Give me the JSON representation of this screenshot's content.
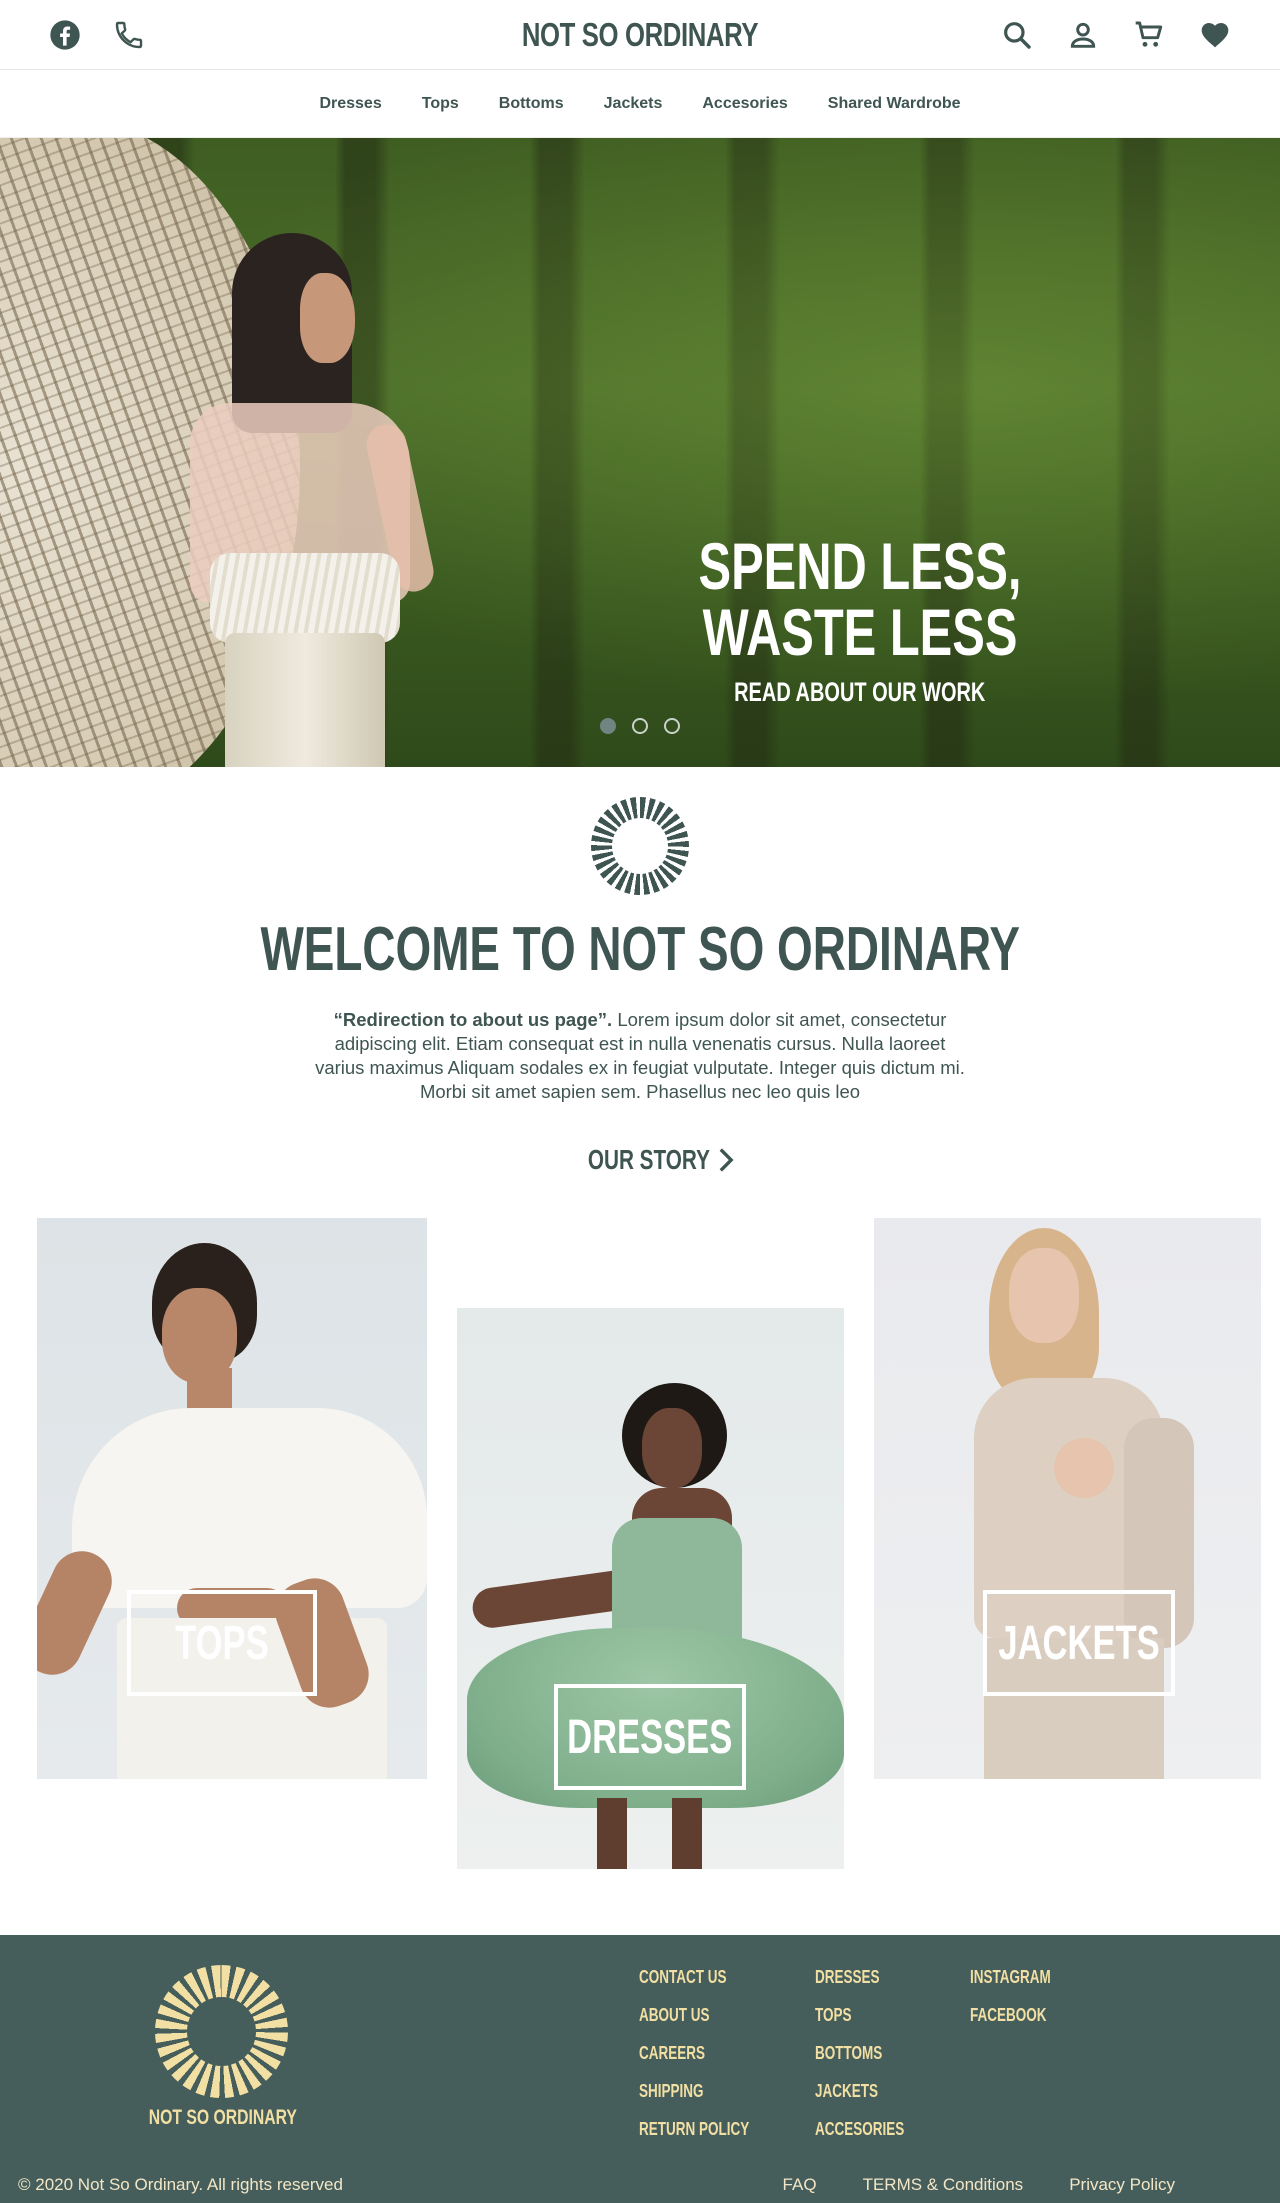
{
  "header": {
    "brand": "NOT SO ORDINARY",
    "left_icons": [
      "facebook-icon",
      "phone-icon"
    ],
    "right_icons": [
      "search-icon",
      "account-icon",
      "cart-icon",
      "heart-icon"
    ]
  },
  "nav": {
    "items": [
      "Dresses",
      "Tops",
      "Bottoms",
      "Jackets",
      "Accesories",
      "Shared Wardrobe"
    ]
  },
  "hero": {
    "headline": "SPEND LESS, WASTE LESS",
    "link": "READ ABOUT OUR WORK",
    "slides": 3,
    "active_slide": 1
  },
  "welcome": {
    "title": "WELCOME TO NOT SO ORDINARY",
    "lead_bold": "“Redirection to about us page”.",
    "body": " Lorem ipsum dolor sit amet, consectetur adipiscing elit. Etiam consequat est in nulla venenatis cursus. Nulla laoreet varius maximus Aliquam sodales ex in feugiat vulputate. Integer quis dictum mi. Morbi sit amet sapien sem. Phasellus nec leo quis leo",
    "cta": "OUR STORY"
  },
  "categories": [
    {
      "label": "TOPS"
    },
    {
      "label": "DRESSES"
    },
    {
      "label": "JACKETS"
    }
  ],
  "footer": {
    "brand": "NOT SO ORDINARY",
    "col1": [
      "CONTACT US",
      "ABOUT US",
      "CAREERS",
      "SHIPPING",
      "RETURN POLICY"
    ],
    "col2": [
      "DRESSES",
      "TOPS",
      "BOTTOMS",
      "JACKETS",
      "ACCESORIES"
    ],
    "col3": [
      "INSTAGRAM",
      "FACEBOOK"
    ],
    "copyright": "© 2020 Not So Ordinary. All rights reserved",
    "legal": [
      "FAQ",
      "TERMS & Conditions",
      "Privacy Policy"
    ]
  },
  "colors": {
    "primary": "#3f5552",
    "footer_bg": "#465e5b",
    "footer_text": "#f2dfa3"
  }
}
